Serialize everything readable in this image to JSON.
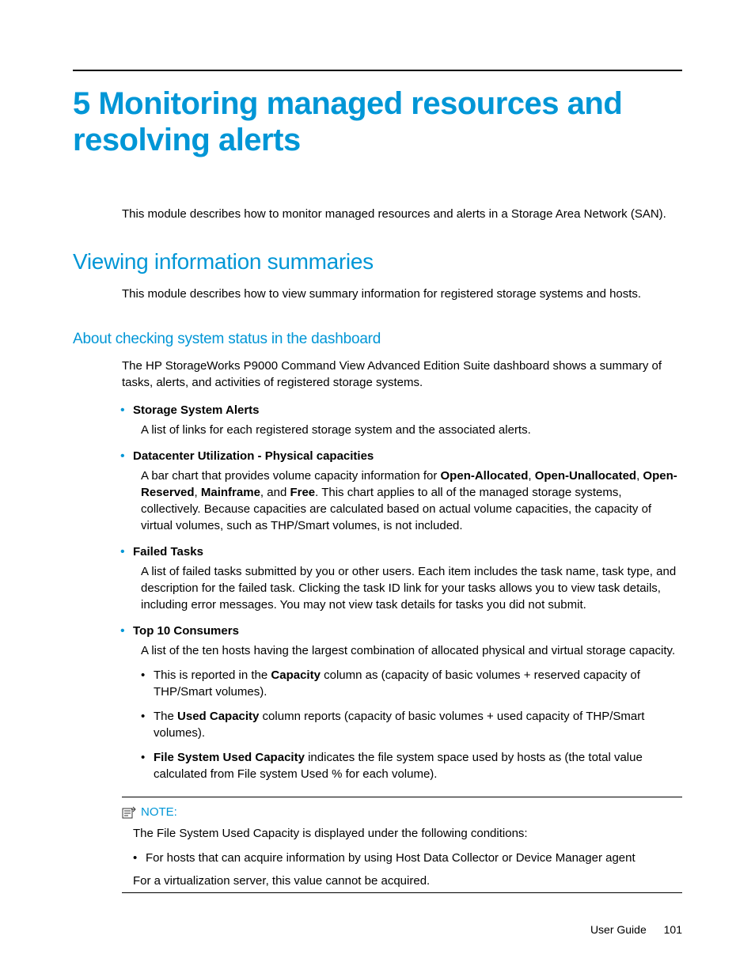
{
  "chapter_title": "5 Monitoring managed resources and resolving alerts",
  "intro": "This module describes how to monitor managed resources and alerts in a Storage Area Network (SAN).",
  "section1": {
    "title": "Viewing information summaries",
    "text": "This module describes how to view summary information for registered storage systems and hosts."
  },
  "section2": {
    "title": "About checking system status in the dashboard",
    "intro": "The HP StorageWorks P9000 Command View Advanced Edition Suite dashboard shows a summary of tasks, alerts, and activities of registered storage systems.",
    "items": [
      {
        "title": "Storage System Alerts",
        "body": "A list of links for each registered storage system and the associated alerts."
      },
      {
        "title": "Datacenter Utilization - Physical capacities",
        "body_pre": "A bar chart that provides volume capacity information for ",
        "bold1": "Open-Allocated",
        "sep1": ", ",
        "bold2": "Open-Unallocated",
        "sep2": ", ",
        "bold3": "Open-Reserved",
        "sep3": ", ",
        "bold4": "Mainframe",
        "sep4": ", and ",
        "bold5": "Free",
        "body_post": ". This chart applies to all of the managed storage systems, collectively. Because capacities are calculated based on actual volume capacities, the capacity of virtual volumes, such as THP/Smart volumes, is not included."
      },
      {
        "title": "Failed Tasks",
        "body": "A list of failed tasks submitted by you or other users. Each item includes the task name, task type, and description for the failed task. Clicking the task ID link for your tasks allows you to view task details, including error messages. You may not view task details for tasks you did not submit."
      },
      {
        "title": "Top 10 Consumers",
        "body": "A list of the ten hosts having the largest combination of allocated physical and virtual storage capacity.",
        "nested": [
          {
            "pre": "This is reported in the ",
            "bold": "Capacity",
            "post": " column as (capacity of basic volumes + reserved capacity of THP/Smart volumes)."
          },
          {
            "pre": "The ",
            "bold": "Used Capacity",
            "post": " column reports (capacity of basic volumes + used capacity of THP/Smart volumes)."
          },
          {
            "pre": "",
            "bold": "File System Used Capacity",
            "post": " indicates the file system space used by hosts as (the total value calculated from File system Used % for each volume)."
          }
        ]
      }
    ]
  },
  "note": {
    "label": "NOTE:",
    "text": "The File System Used Capacity is displayed under the following conditions:",
    "items": [
      "For hosts that can acquire information by using Host Data Collector or Device Manager agent"
    ],
    "closing": "For a virtualization server, this value cannot be acquired."
  },
  "footer": {
    "label": "User Guide",
    "page": "101"
  }
}
